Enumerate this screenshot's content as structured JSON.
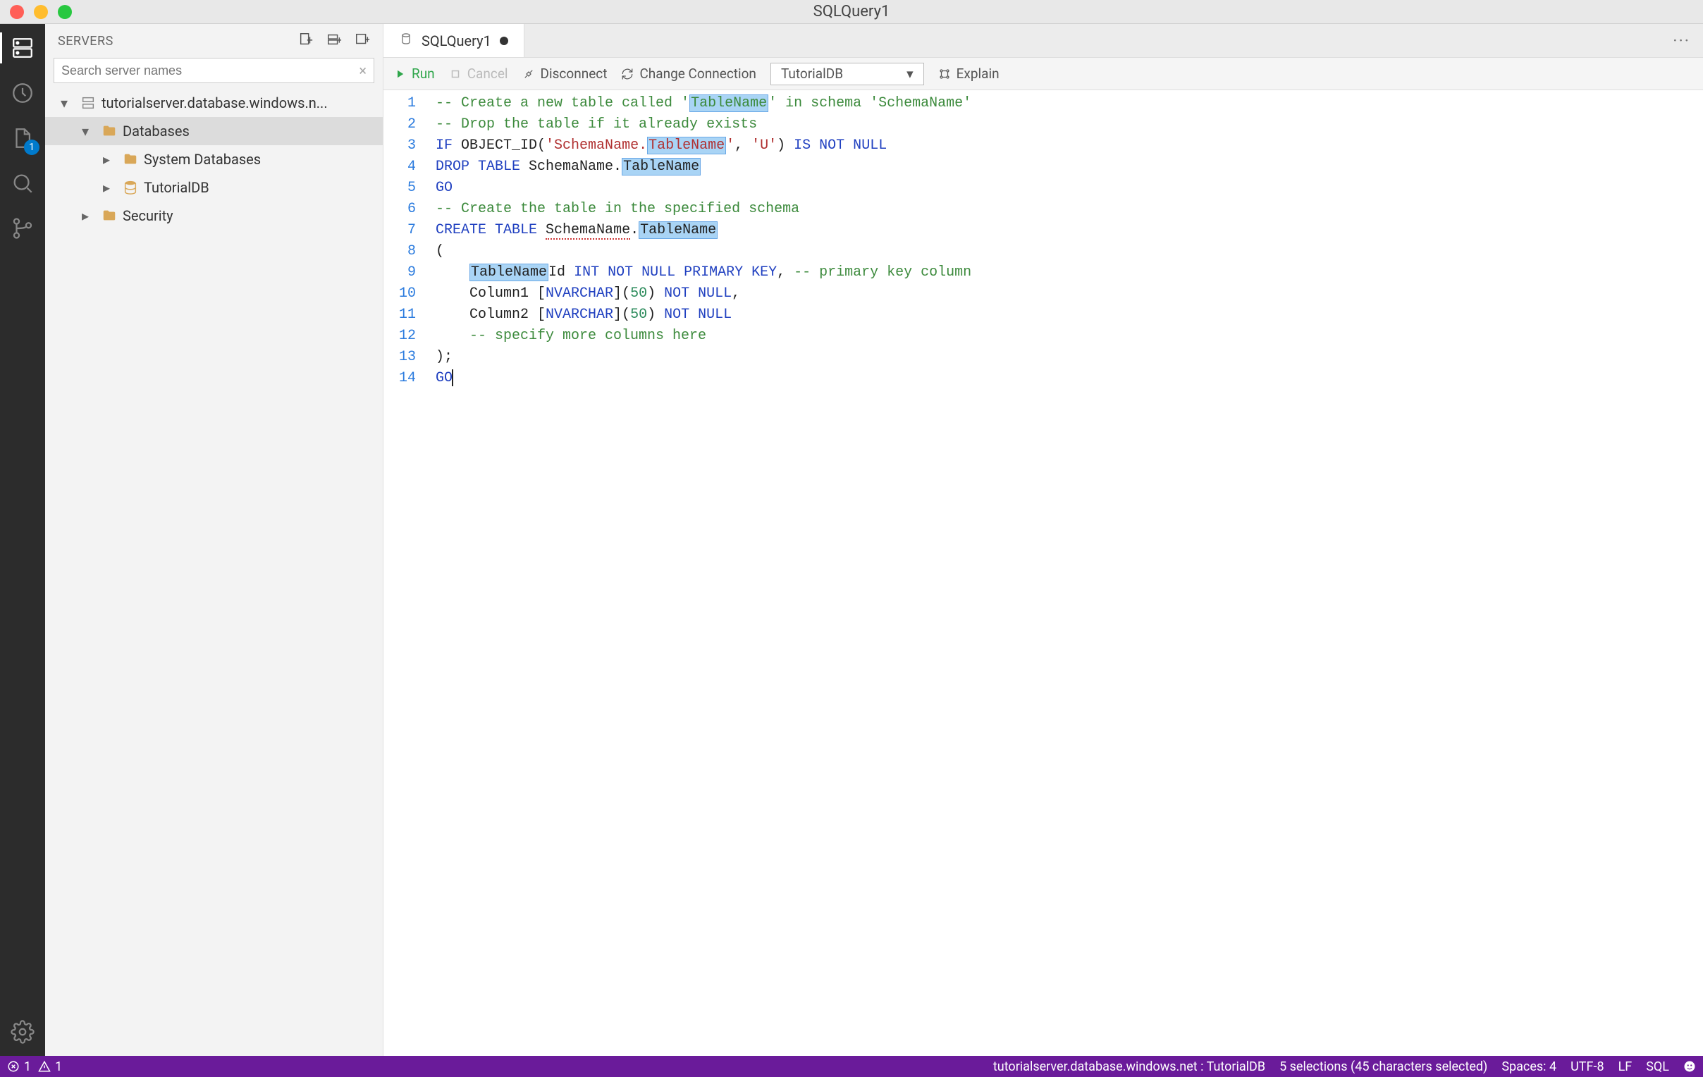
{
  "window": {
    "title": "SQLQuery1"
  },
  "sidebar": {
    "header": "SERVERS",
    "search_placeholder": "Search server names",
    "server": "tutorialserver.database.windows.n...",
    "nodes": {
      "databases": "Databases",
      "system_dbs": "System Databases",
      "tutorial_db": "TutorialDB",
      "security": "Security"
    }
  },
  "tab": {
    "label": "SQLQuery1"
  },
  "toolbar": {
    "run": "Run",
    "cancel": "Cancel",
    "disconnect": "Disconnect",
    "change_conn": "Change Connection",
    "db_selected": "TutorialDB",
    "explain": "Explain"
  },
  "code": {
    "l1_a": "-- Create a new table called '",
    "l1_b": "TableName",
    "l1_c": "' in schema '",
    "l1_d": "SchemaName",
    "l1_e": "'",
    "l2": "-- Drop the table if it already exists",
    "l3_a": "IF",
    "l3_b": " OBJECT_ID(",
    "l3_c": "'SchemaName.",
    "l3_d": "TableName",
    "l3_e": "'",
    "l3_f": ", ",
    "l3_g": "'U'",
    "l3_h": ") ",
    "l3_i": "IS NOT NULL",
    "l4_a": "DROP TABLE",
    "l4_b": " SchemaName.",
    "l4_c": "TableName",
    "l5": "GO",
    "l6": "-- Create the table in the specified schema",
    "l7_a": "CREATE TABLE",
    "l7_b": " ",
    "l7_c": "SchemaName",
    "l7_d": ".",
    "l7_e": "TableName",
    "l8": "(",
    "l9_a": "    ",
    "l9_b": "TableName",
    "l9_c": "Id ",
    "l9_d": "INT NOT NULL PRIMARY KEY",
    "l9_e": ", ",
    "l9_f": "-- primary key column",
    "l10_a": "    Column1 [",
    "l10_b": "NVARCHAR",
    "l10_c": "](",
    "l10_d": "50",
    "l10_e": ") ",
    "l10_f": "NOT NULL",
    "l10_g": ",",
    "l11_a": "    Column2 [",
    "l11_b": "NVARCHAR",
    "l11_c": "](",
    "l11_d": "50",
    "l11_e": ") ",
    "l11_f": "NOT NULL",
    "l12": "    -- specify more columns here",
    "l13": ");",
    "l14": "GO"
  },
  "status": {
    "errors": "1",
    "warnings": "1",
    "connection": "tutorialserver.database.windows.net : TutorialDB",
    "selections": "5 selections (45 characters selected)",
    "spaces": "Spaces: 4",
    "encoding": "UTF-8",
    "eol": "LF",
    "lang": "SQL"
  },
  "badge_count": "1"
}
